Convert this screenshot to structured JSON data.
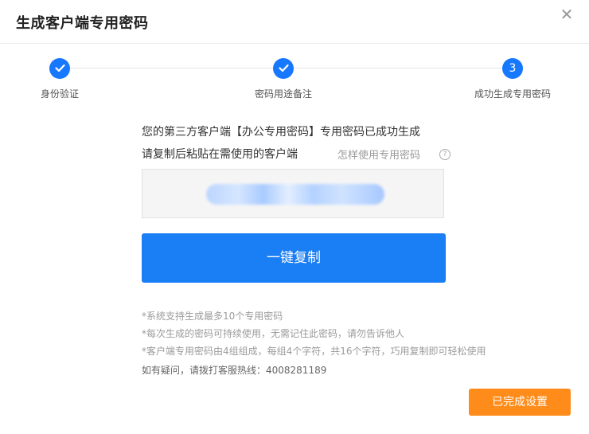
{
  "dialog": {
    "title": "生成客户端专用密码",
    "close_glyph": "✕"
  },
  "steps": [
    {
      "label": "身份验证",
      "state": "done"
    },
    {
      "label": "密码用途备注",
      "state": "done"
    },
    {
      "label": "成功生成专用密码",
      "state": "active",
      "number": "3"
    }
  ],
  "message": {
    "line1": "您的第三方客户端【办公专用密码】专用密码已成功生成",
    "line2": "请复制后粘贴在需使用的客户端",
    "help_link": "怎样使用专用密码",
    "help_icon_glyph": "?"
  },
  "copy_button": {
    "label": "一键复制"
  },
  "notes": [
    "*系统支持生成最多10个专用密码",
    "*每次生成的密码可持续使用，无需记住此密码，请勿告诉他人",
    "*客户端专用密码由4组组成，每组4个字符，共16个字符，巧用复制即可轻松使用"
  ],
  "hotline": "如有疑问，请拨打客服热线：4008281189",
  "done_button": {
    "label": "已完成设置"
  },
  "colors": {
    "primary": "#1a7ef5",
    "step": "#1677ff",
    "done": "#ff8c1a"
  }
}
